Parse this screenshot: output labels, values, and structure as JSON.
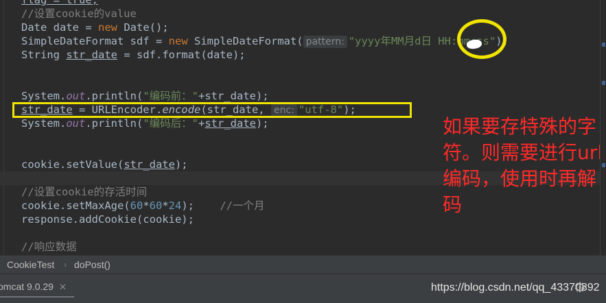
{
  "code": {
    "line0": "flag = true;",
    "line1_comment": "//设置cookie的value",
    "line2": {
      "type": "Date",
      "var": "date",
      "kw_new": "new",
      "ctor": "Date();"
    },
    "line3": {
      "type": "SimpleDateFormat",
      "var": "sdf",
      "kw_new": "new",
      "ctor": "SimpleDateFormat(",
      "hint": "pattern:",
      "str": "\"yyyy年MM月d日 HH:mm:ss\"",
      "end": ");"
    },
    "line4": {
      "type": "String",
      "var": "str_date",
      "rest": " = sdf.format(date);"
    },
    "line5": {
      "obj": "System.",
      "fld": "out",
      "call": ".println(",
      "str": "\"编码前：\"",
      "rest": "+str_date);"
    },
    "line6": {
      "var": "str_date",
      "mid": " = URLEncoder.",
      "method": "encode",
      "args": "(str_date, ",
      "hint": "enc:",
      "str": "\"utf-8\"",
      "end": ");"
    },
    "line7": {
      "obj": "System.",
      "fld": "out",
      "call": ".println(",
      "str": "\"编码后：\"",
      "mid": "+",
      "var": "str_date",
      "end": ");"
    },
    "line8": {
      "pre": "cookie.setValue(",
      "var": "str_date",
      "end": ");"
    },
    "line9_comment": "//设置cookie的存活时间",
    "line10": {
      "pre": "cookie.setMaxAge(",
      "n1": "60",
      "op1": "*",
      "n2": "60",
      "op2": "*",
      "n3": "24",
      "end": ");",
      "comment": "//一个月"
    },
    "line11": "response.addCookie(cookie);",
    "line12_comment": "//响应数据"
  },
  "annotation": "如果要存特殊的字符。则需要进行url编码，使用时再解码",
  "breadcrumb": {
    "item1": "CookieTest",
    "sep": "›",
    "item2": "doPost()"
  },
  "status": {
    "tab_label": "omcat 9.0.29",
    "tab_close": "✕",
    "watermark": "https://blog.csdn.net/qq_43370892"
  },
  "colors": {
    "keyword": "#cc7832",
    "string": "#6a8759",
    "comment": "#808080",
    "number": "#6897bb",
    "field": "#9876aa",
    "highlight": "#f0e400",
    "annotation": "#ff2a2a"
  }
}
